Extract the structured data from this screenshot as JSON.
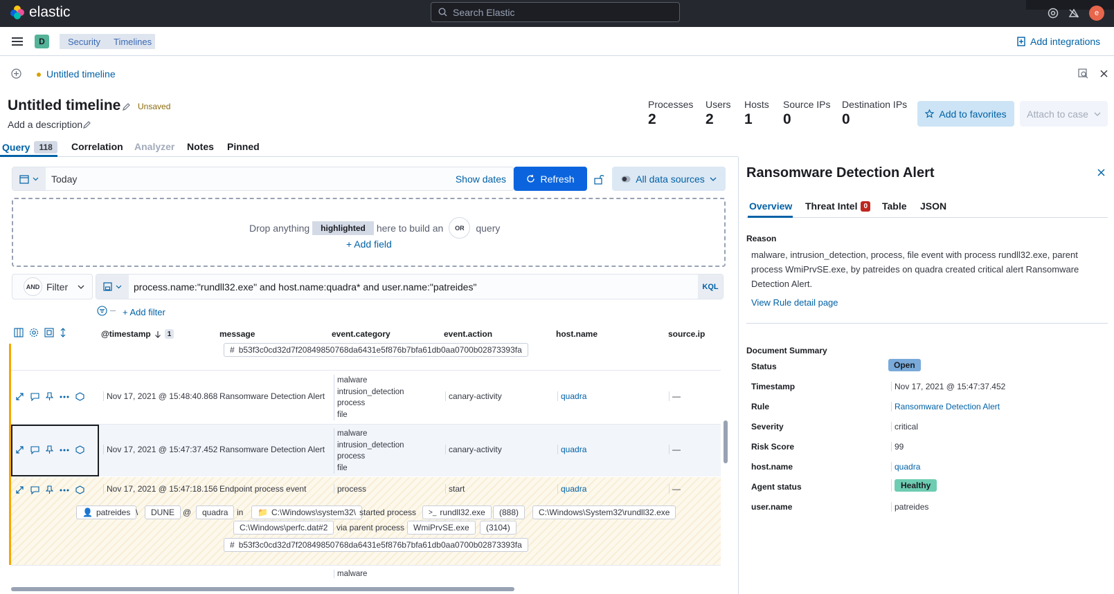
{
  "app": {
    "brand": "elastic",
    "search_placeholder": "Search Elastic",
    "avatar_initial": "e"
  },
  "subheader": {
    "space_badge": "D",
    "breadcrumbs": [
      "Security",
      "Timelines"
    ],
    "add_integrations": "Add integrations"
  },
  "timeline_bar": {
    "title": "Untitled timeline"
  },
  "timeline": {
    "title": "Untitled timeline",
    "status": "Unsaved",
    "description_placeholder": "Add a description",
    "stats": [
      {
        "label": "Processes",
        "value": "2"
      },
      {
        "label": "Users",
        "value": "2"
      },
      {
        "label": "Hosts",
        "value": "1"
      },
      {
        "label": "Source IPs",
        "value": "0"
      },
      {
        "label": "Destination IPs",
        "value": "0"
      }
    ],
    "add_to_favorites": "Add to favorites",
    "attach_to_case": "Attach to case",
    "tabs": [
      {
        "label": "Query",
        "count": "118"
      },
      {
        "label": "Correlation"
      },
      {
        "label": "Analyzer"
      },
      {
        "label": "Notes"
      },
      {
        "label": "Pinned"
      }
    ]
  },
  "query": {
    "date_value": "Today",
    "show_dates": "Show dates",
    "refresh": "Refresh",
    "data_sources": "All data sources",
    "drop_zone": {
      "pre": "Drop anything",
      "highlight": "highlighted",
      "post": "here to build an",
      "or": "OR",
      "query_word": "query",
      "add_field": "+ Add field"
    },
    "and_badge": "AND",
    "filter_label": "Filter",
    "kql_text": "process.name:\"rundll32.exe\" and host.name:quadra* and user.name:\"patreides\"",
    "kql_badge": "KQL",
    "add_filter": "+ Add filter"
  },
  "table": {
    "columns": [
      "@timestamp",
      "message",
      "event.category",
      "event.action",
      "host.name",
      "source.ip"
    ],
    "sort_count": "1",
    "hash_top": "b53f3c0cd32d7f20849850768da6431e5f876b7bfa61db0aa0700b02873393fa",
    "rows": [
      {
        "timestamp": "Nov 17, 2021 @ 15:48:40.868",
        "message": "Ransomware Detection Alert",
        "categories": [
          "malware",
          "intrusion_detection",
          "process",
          "file"
        ],
        "action": "canary-activity",
        "host": "quadra",
        "source_ip": "—"
      },
      {
        "timestamp": "Nov 17, 2021 @ 15:47:37.452",
        "message": "Ransomware Detection Alert",
        "categories": [
          "malware",
          "intrusion_detection",
          "process",
          "file"
        ],
        "action": "canary-activity",
        "host": "quadra",
        "source_ip": "—"
      },
      {
        "timestamp": "Nov 17, 2021 @ 15:47:18.156",
        "message": "Endpoint process event",
        "categories": [
          "process"
        ],
        "action": "start",
        "host": "quadra",
        "source_ip": "—"
      }
    ],
    "process_chips": {
      "user": "patreides",
      "sep": "\\",
      "domain": "DUNE",
      "at": "@",
      "host": "quadra",
      "in": "in",
      "dir": "C:\\Windows\\system32\\",
      "started": "started process",
      "process": "rundll32.exe",
      "pid": "(888)",
      "exe": "C:\\Windows\\System32\\rundll32.exe",
      "args": "C:\\Windows\\perfc.dat#2",
      "via": "via parent process",
      "parent": "WmiPrvSE.exe",
      "ppid": "(3104)",
      "hash": "b53f3c0cd32d7f20849850768da6431e5f876b7bfa61db0aa0700b02873393fa"
    },
    "last_row_category": "malware"
  },
  "flyout": {
    "title": "Ransomware Detection Alert",
    "tabs": [
      "Overview",
      "Threat Intel",
      "Table",
      "JSON"
    ],
    "threat_intel_count": "0",
    "reason_label": "Reason",
    "reason_text": "malware, intrusion_detection, process, file event with process rundll32.exe, parent process WmiPrvSE.exe, by patreides on quadra created critical alert Ransomware Detection Alert.",
    "view_rule": "View Rule detail page",
    "summary_title": "Document Summary",
    "summary": [
      {
        "label": "Status",
        "value": "Open"
      },
      {
        "label": "Timestamp",
        "value": "Nov 17, 2021 @ 15:47:37.452"
      },
      {
        "label": "Rule",
        "value": "Ransomware Detection Alert"
      },
      {
        "label": "Severity",
        "value": "critical"
      },
      {
        "label": "Risk Score",
        "value": "99"
      },
      {
        "label": "host.name",
        "value": "quadra"
      },
      {
        "label": "Agent status",
        "value": "Healthy"
      },
      {
        "label": "user.name",
        "value": "patreides"
      }
    ]
  },
  "colors": {
    "primary": "#0b64dd",
    "link": "#0061a6",
    "topbar": "#25282f",
    "healthy": "#6dccb1",
    "open": "#79aad9",
    "pinned_bar": "#f5a700"
  }
}
